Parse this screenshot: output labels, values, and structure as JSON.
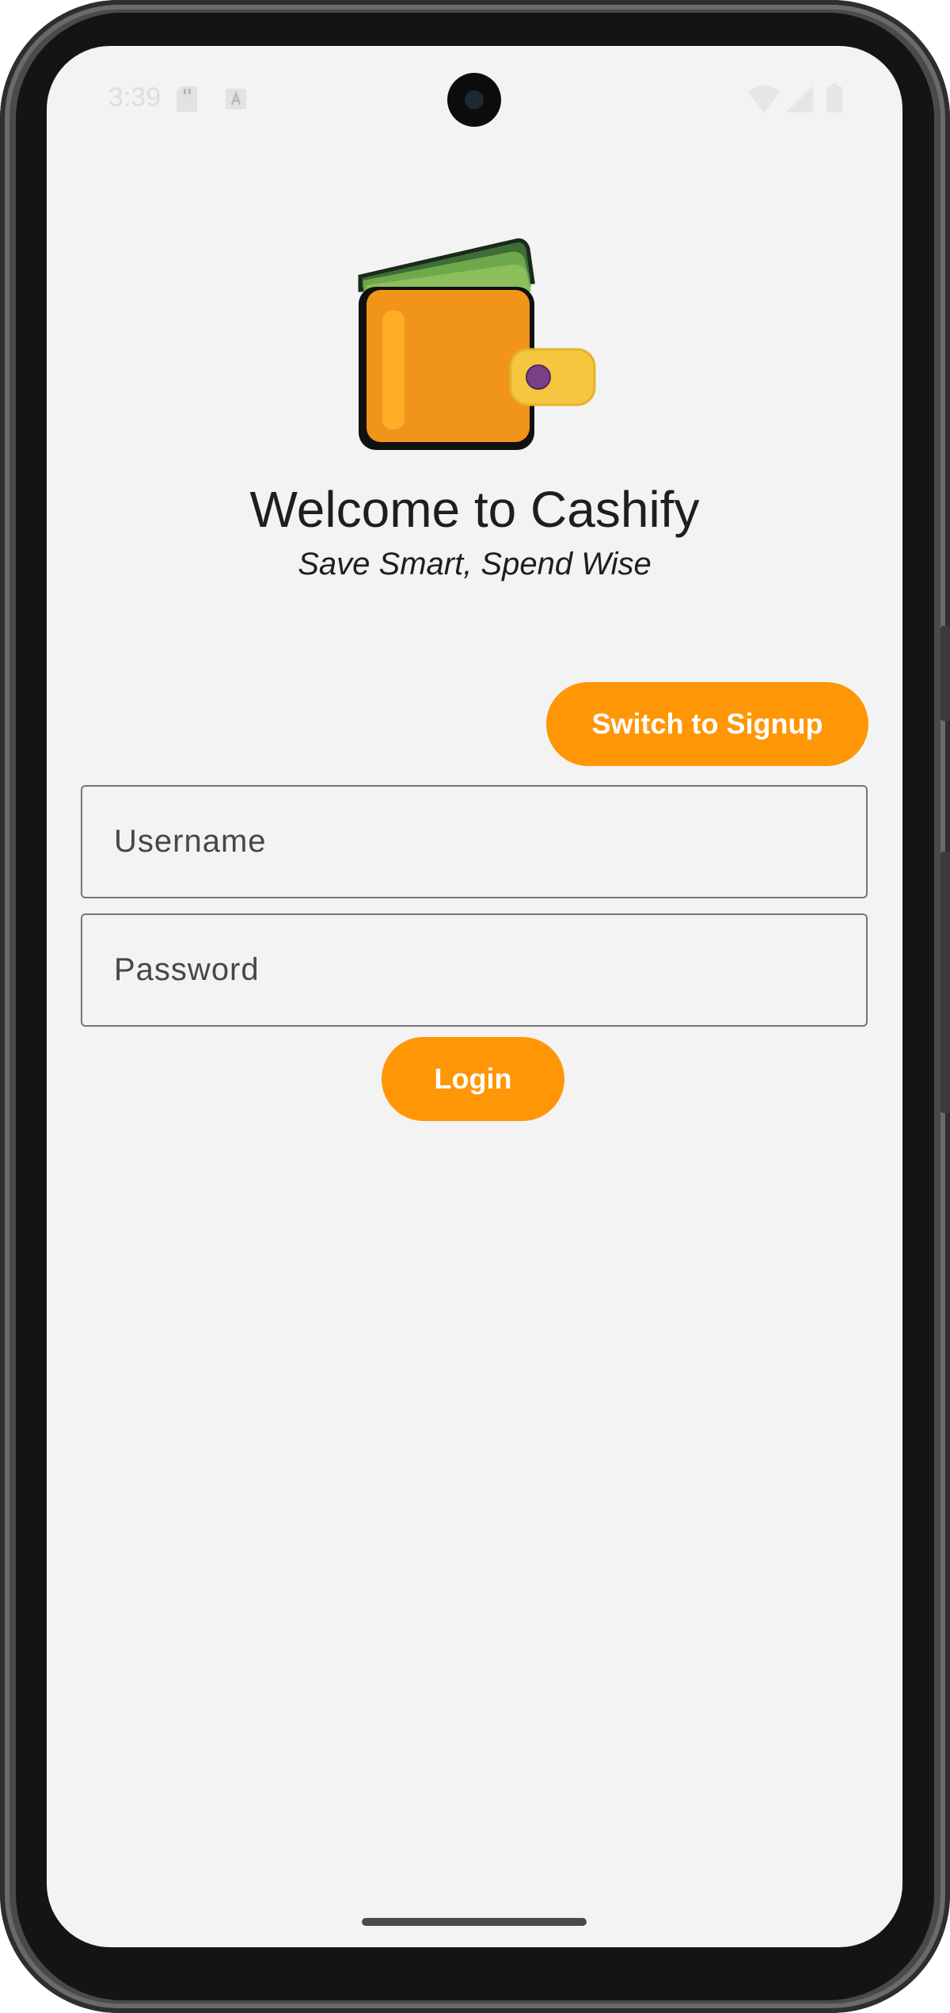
{
  "status_bar": {
    "time": "3:39",
    "left_icons": [
      "sd-card-icon",
      "notification-a-icon"
    ],
    "right_icons": [
      "wifi-icon",
      "cellular-signal-icon",
      "battery-icon"
    ]
  },
  "app": {
    "logo": "wallet-logo",
    "title": "Welcome to Cashify",
    "subtitle": "Save Smart, Spend Wise"
  },
  "auth": {
    "switch_label": "Switch to Signup",
    "username_placeholder": "Username",
    "username_value": "",
    "password_placeholder": "Password",
    "password_value": "",
    "login_label": "Login"
  },
  "colors": {
    "accent": "#ff9606",
    "background": "#f3f3f3",
    "text": "#1e1e1e",
    "field_border": "#76767a"
  }
}
